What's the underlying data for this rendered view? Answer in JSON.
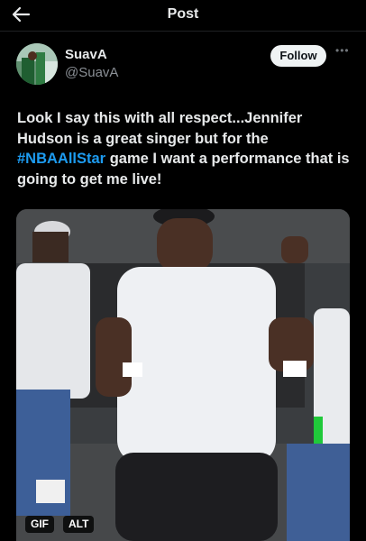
{
  "header": {
    "title": "Post",
    "back_icon": "arrow-left-icon"
  },
  "author": {
    "display_name": "SuavA",
    "handle": "@SuavA",
    "avatar_icon": "avatar"
  },
  "actions": {
    "follow_label": "Follow",
    "more_icon": "more-horizontal-icon"
  },
  "post": {
    "text_before": "Look I say this with all respect...Jennifer Hudson is a great singer but for the ",
    "hashtag": "#NBAAllStar",
    "text_after": " game I want a performance that is going to get me live!"
  },
  "media": {
    "type_badge": "GIF",
    "alt_badge": "ALT"
  },
  "colors": {
    "background": "#000000",
    "text": "#e7e9ea",
    "secondary_text": "#8b9096",
    "link": "#1d9bf0",
    "follow_bg": "#eff3f4"
  }
}
